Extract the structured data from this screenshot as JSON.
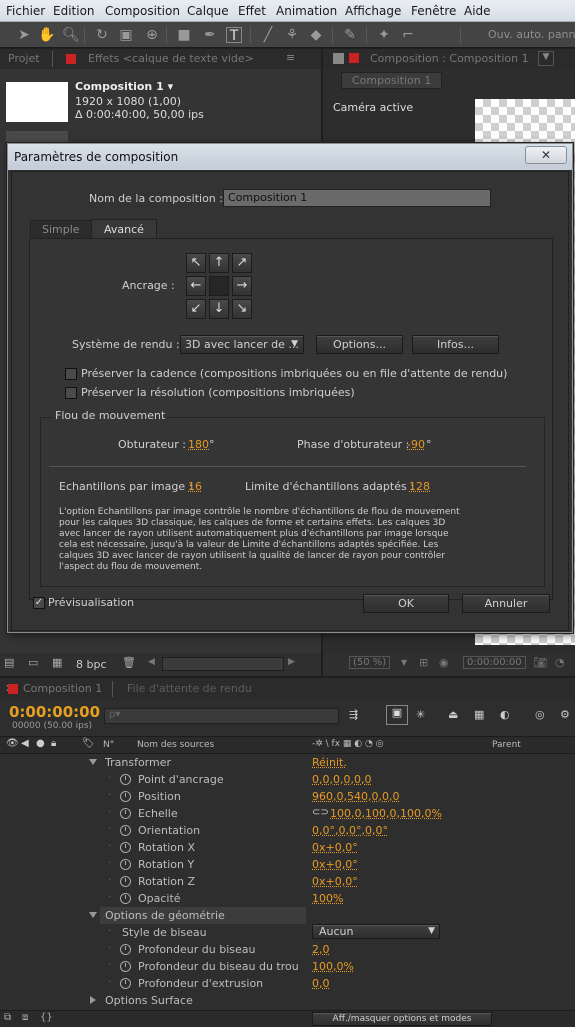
{
  "menu": [
    "Fichier",
    "Edition",
    "Composition",
    "Calque",
    "Effet",
    "Animation",
    "Affichage",
    "Fenêtre",
    "Aide"
  ],
  "toolbar": {
    "auto_label": "Ouv. auto. panne"
  },
  "project_panel": {
    "tab_project": "Projet",
    "tab_effects": "Effets <calque de texte vide>",
    "comp_name": "Composition 1 ▾",
    "comp_size": "1920 x 1080 (1,00)",
    "comp_duration": "Δ 0:00:40:00, 50,00 ips",
    "bpc": "8 bpc"
  },
  "comp_panel": {
    "tab_label": "Composition : Composition 1",
    "sub_tab": "Composition 1",
    "camera": "Caméra active",
    "zoom": "(50 %)",
    "timecode": "0:00:00:00"
  },
  "dialog": {
    "title": "Paramètres de composition",
    "close": "✕",
    "name_label": "Nom de la composition :",
    "name_value": "Composition 1",
    "tab_simple": "Simple",
    "tab_advanced": "Avancé",
    "anchor_label": "Ancrage :",
    "render_label": "Système de rendu :",
    "render_value": "3D avec lancer de ...",
    "options_btn": "Options...",
    "infos_btn": "Infos...",
    "preserve_framerate": "Préserver la cadence (compositions imbriquées ou en file d'attente de rendu)",
    "preserve_resolution": "Préserver la résolution (compositions imbriquées)",
    "motion_blur_title": "Flou de mouvement",
    "shutter_label": "Obturateur :",
    "shutter_value": "180",
    "shutter_unit": "°",
    "phase_label": "Phase d'obturateur :",
    "phase_value": "-90",
    "phase_unit": "°",
    "samples_label": "Echantillons par image :",
    "samples_value": "16",
    "adaptive_label": "Limite d'échantillons adaptés :",
    "adaptive_value": "128",
    "help_text": "L'option Echantillons par image contrôle le nombre d'échantillons de flou de mouvement pour les calques 3D classique, les calques de forme et certains effets. Les calques 3D avec lancer de rayon utilisent automatiquement plus d'échantillons par image lorsque cela est nécessaire, jusqu'à la valeur de Limite d'échantillons adaptés spécifiée. Les calques 3D avec lancer de rayon utilisent la qualité de lancer de rayon pour contrôler l'aspect du flou de mouvement.",
    "preview_label": "Prévisualisation",
    "ok": "OK",
    "cancel": "Annuler"
  },
  "timeline": {
    "tab_comp": "Composition 1",
    "tab_queue": "File d'attente de rendu",
    "timecode": "0:00:00:00",
    "fps": "00000 (50.00 ips)",
    "search_placeholder": "ρ▾",
    "col_num": "N°",
    "col_source": "Nom des sources",
    "col_parent": "Parent",
    "switches": "-✲ \\ fx ▦ ◐ ◔ ◎",
    "bottom_toggle": "Aff./masquer options et modes",
    "rows": [
      {
        "name": "Transformer",
        "value": "Réinit."
      },
      {
        "name": "Point d'ancrage",
        "value": "0,0,0,0,0,0"
      },
      {
        "name": "Position",
        "value": "960,0,540,0,0,0"
      },
      {
        "name": "Echelle",
        "value": "100,0,100,0,100,0%"
      },
      {
        "name": "Orientation",
        "value": "0,0°,0,0°,0,0°"
      },
      {
        "name": "Rotation X",
        "value": "0x+0,0°"
      },
      {
        "name": "Rotation Y",
        "value": "0x+0,0°"
      },
      {
        "name": "Rotation Z",
        "value": "0x+0,0°"
      },
      {
        "name": "Opacité",
        "value": "100%"
      },
      {
        "name": "Options de géométrie",
        "value": ""
      },
      {
        "name": "Style de biseau",
        "value": "Aucun"
      },
      {
        "name": "Profondeur du biseau",
        "value": "2,0"
      },
      {
        "name": "Profondeur du biseau du trou",
        "value": "100,0%"
      },
      {
        "name": "Profondeur d'extrusion",
        "value": "0,0"
      },
      {
        "name": "Options Surface",
        "value": ""
      }
    ]
  }
}
